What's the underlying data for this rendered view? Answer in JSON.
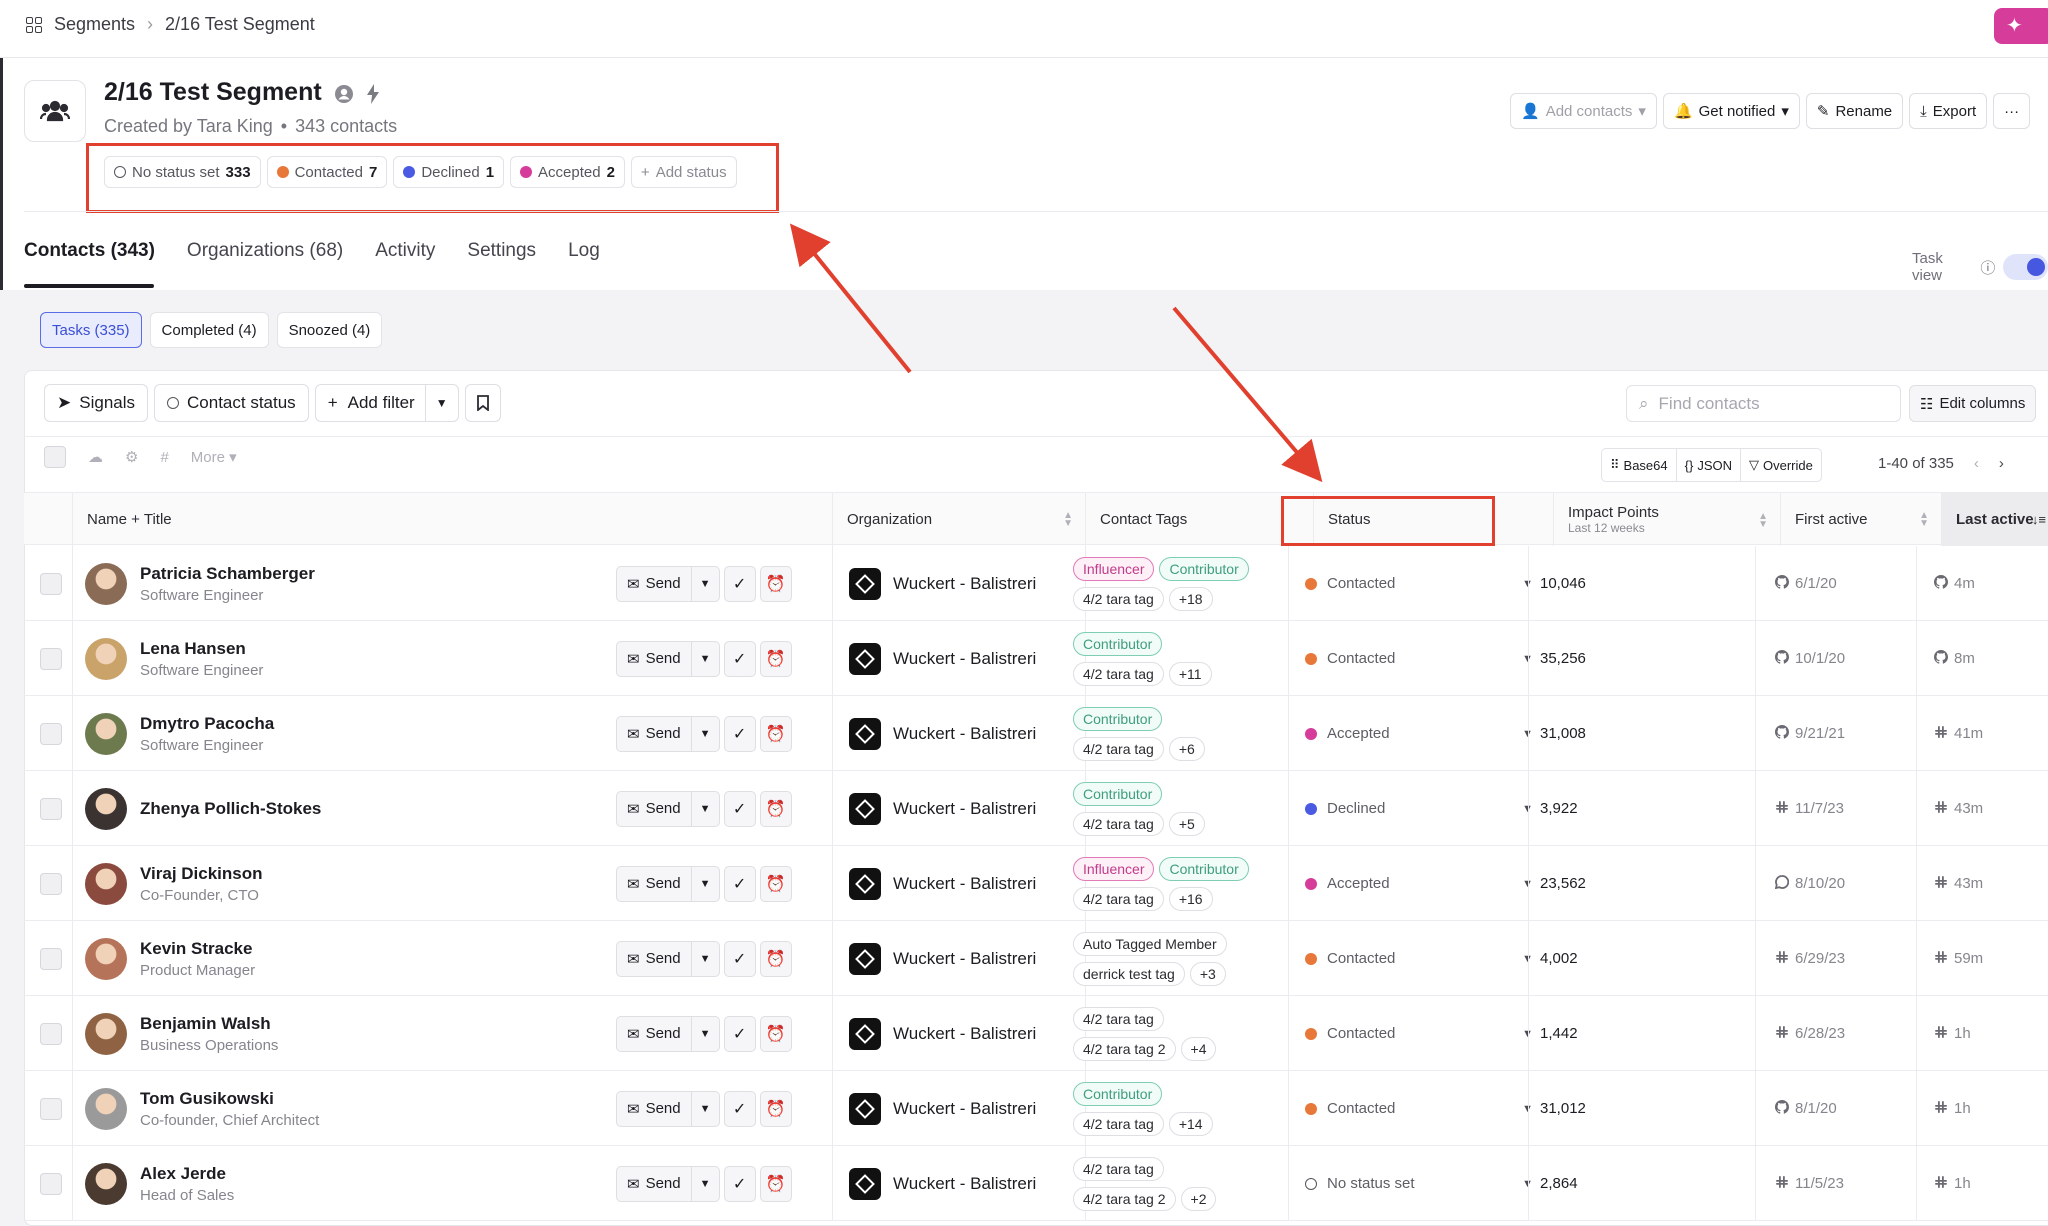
{
  "breadcrumb": {
    "root": "Segments",
    "current": "2/16 Test Segment"
  },
  "segment": {
    "title": "2/16 Test Segment",
    "created_by": "Created by Tara King",
    "contacts": "343 contacts"
  },
  "statuses": [
    {
      "label": "No status set",
      "count": "333",
      "color": "#ffffff"
    },
    {
      "label": "Contacted",
      "count": "7",
      "color": "#e8783a"
    },
    {
      "label": "Declined",
      "count": "1",
      "color": "#4a5ae3"
    },
    {
      "label": "Accepted",
      "count": "2",
      "color": "#d63d9a"
    }
  ],
  "add_status": "Add status",
  "actions": {
    "add_contacts": "Add contacts",
    "get_notified": "Get notified",
    "rename": "Rename",
    "export": "Export",
    "more": "···"
  },
  "tabs": [
    "Contacts (343)",
    "Organizations (68)",
    "Activity",
    "Settings",
    "Log"
  ],
  "task_view": "Task view",
  "subtabs": [
    "Tasks (335)",
    "Completed (4)",
    "Snoozed (4)"
  ],
  "filters": {
    "signals": "Signals",
    "contact_status": "Contact status",
    "add_filter": "Add filter"
  },
  "search": {
    "placeholder": "Find contacts"
  },
  "edit_columns": "Edit columns",
  "bulk": {
    "more": "More"
  },
  "export_btns": {
    "base64": "Base64",
    "json": "JSON",
    "override": "Override"
  },
  "pager": "1-40 of 335",
  "columns": {
    "name": "Name + Title",
    "organization": "Organization",
    "tags": "Contact Tags",
    "status": "Status",
    "impact": "Impact Points",
    "impact_sub": "Last 12 weeks",
    "first_active": "First active",
    "last_active": "Last active"
  },
  "send_label": "Send",
  "rows": [
    {
      "name": "Patricia Schamberger",
      "title": "Software Engineer",
      "org": "Wuckert - Balistreri",
      "tags1": [
        "Influencer",
        "Contributor"
      ],
      "tags2": [
        "4/2 tara tag",
        "+18"
      ],
      "status": "Contacted",
      "status_color": "#e8783a",
      "impact": "10,046",
      "first": "6/1/20",
      "first_icon": "github",
      "last": "4m",
      "last_icon": "github",
      "avatar": "#8a6b55"
    },
    {
      "name": "Lena Hansen",
      "title": "Software Engineer",
      "org": "Wuckert - Balistreri",
      "tags1": [
        "Contributor"
      ],
      "tags2": [
        "4/2 tara tag",
        "+11"
      ],
      "status": "Contacted",
      "status_color": "#e8783a",
      "impact": "35,256",
      "first": "10/1/20",
      "first_icon": "github",
      "last": "8m",
      "last_icon": "github",
      "avatar": "#c9a36a"
    },
    {
      "name": "Dmytro Pacocha",
      "title": "Software Engineer",
      "org": "Wuckert - Balistreri",
      "tags1": [
        "Contributor"
      ],
      "tags2": [
        "4/2 tara tag",
        "+6"
      ],
      "status": "Accepted",
      "status_color": "#d63d9a",
      "impact": "31,008",
      "first": "9/21/21",
      "first_icon": "github",
      "last": "41m",
      "last_icon": "slack",
      "avatar": "#6d7a4e"
    },
    {
      "name": "Zhenya Pollich-Stokes",
      "title": "",
      "org": "Wuckert - Balistreri",
      "tags1": [
        "Contributor"
      ],
      "tags2": [
        "4/2 tara tag",
        "+5"
      ],
      "status": "Declined",
      "status_color": "#4a5ae3",
      "impact": "3,922",
      "first": "11/7/23",
      "first_icon": "slack",
      "last": "43m",
      "last_icon": "slack",
      "avatar": "#3b3232"
    },
    {
      "name": "Viraj Dickinson",
      "title": "Co-Founder, CTO",
      "org": "Wuckert - Balistreri",
      "tags1": [
        "Influencer",
        "Contributor"
      ],
      "tags2": [
        "4/2 tara tag",
        "+16"
      ],
      "status": "Accepted",
      "status_color": "#d63d9a",
      "impact": "23,562",
      "first": "8/10/20",
      "first_icon": "discourse",
      "last": "43m",
      "last_icon": "slack",
      "avatar": "#8a4a3e"
    },
    {
      "name": "Kevin Stracke",
      "title": "Product Manager",
      "org": "Wuckert - Balistreri",
      "tags1": [
        "Auto Tagged Member"
      ],
      "tags2": [
        "derrick test tag",
        "+3"
      ],
      "status": "Contacted",
      "status_color": "#e8783a",
      "impact": "4,002",
      "first": "6/29/23",
      "first_icon": "slack",
      "last": "59m",
      "last_icon": "slack",
      "avatar": "#b5735a"
    },
    {
      "name": "Benjamin Walsh",
      "title": "Business Operations",
      "org": "Wuckert - Balistreri",
      "tags1": [
        "4/2 tara tag"
      ],
      "tags2": [
        "4/2 tara tag 2",
        "+4"
      ],
      "status": "Contacted",
      "status_color": "#e8783a",
      "impact": "1,442",
      "first": "6/28/23",
      "first_icon": "slack",
      "last": "1h",
      "last_icon": "slack",
      "avatar": "#8e6242"
    },
    {
      "name": "Tom Gusikowski",
      "title": "Co-founder, Chief Architect",
      "org": "Wuckert - Balistreri",
      "tags1": [
        "Contributor"
      ],
      "tags2": [
        "4/2 tara tag",
        "+14"
      ],
      "status": "Contacted",
      "status_color": "#e8783a",
      "impact": "31,012",
      "first": "8/1/20",
      "first_icon": "github",
      "last": "1h",
      "last_icon": "slack",
      "avatar": "#9a9a9a"
    },
    {
      "name": "Alex Jerde",
      "title": "Head of Sales",
      "org": "Wuckert - Balistreri",
      "tags1": [
        "4/2 tara tag"
      ],
      "tags2": [
        "4/2 tara tag 2",
        "+2"
      ],
      "status": "No status set",
      "status_color": "#ffffff",
      "impact": "2,864",
      "first": "11/5/23",
      "first_icon": "slack",
      "last": "1h",
      "last_icon": "slack",
      "avatar": "#4a3a30"
    }
  ]
}
